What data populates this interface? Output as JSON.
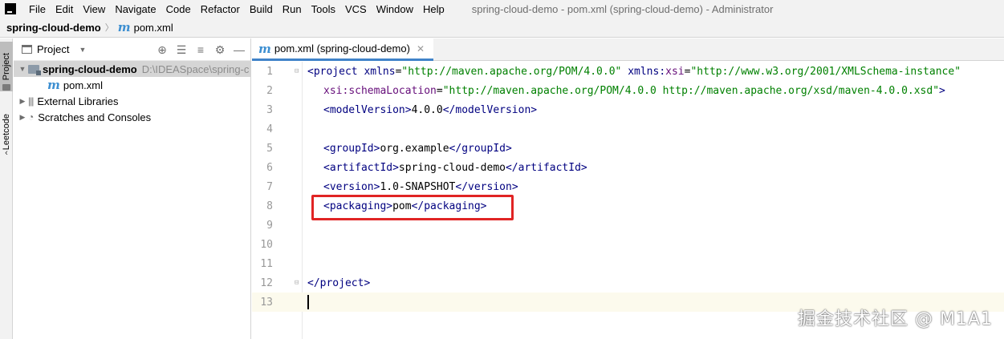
{
  "menubar": {
    "items": [
      {
        "label": "File",
        "mnemonic": "F"
      },
      {
        "label": "Edit",
        "mnemonic": "E"
      },
      {
        "label": "View",
        "mnemonic": "V"
      },
      {
        "label": "Navigate",
        "mnemonic": "N"
      },
      {
        "label": "Code",
        "mnemonic": "C"
      },
      {
        "label": "Refactor",
        "mnemonic": "R"
      },
      {
        "label": "Build",
        "mnemonic": "B"
      },
      {
        "label": "Run",
        "mnemonic": "u"
      },
      {
        "label": "Tools",
        "mnemonic": "T"
      },
      {
        "label": "VCS",
        "mnemonic": "S"
      },
      {
        "label": "Window",
        "mnemonic": "W"
      },
      {
        "label": "Help",
        "mnemonic": "H"
      }
    ],
    "window_title": "spring-cloud-demo - pom.xml (spring-cloud-demo) - Administrator"
  },
  "breadcrumb": {
    "project": "spring-cloud-demo",
    "file_icon": "m",
    "file": "pom.xml"
  },
  "toolstrip": {
    "project_tab": "Project",
    "leetcode_tab": "Leetcode"
  },
  "project_panel": {
    "title": "Project",
    "tree": {
      "root_label": "spring-cloud-demo",
      "root_path": "D:\\IDEASpace\\spring-c",
      "child_icon": "m",
      "child_label": "pom.xml",
      "libraries_label": "External Libraries",
      "scratches_label": "Scratches and Consoles"
    }
  },
  "editor": {
    "tab_icon": "m",
    "tab_label": "pom.xml (spring-cloud-demo)",
    "line_numbers": [
      "1",
      "2",
      "3",
      "4",
      "5",
      "6",
      "7",
      "8",
      "9",
      "10",
      "11",
      "12",
      "13"
    ],
    "code": {
      "l1_open": "<project ",
      "l1_attr1": "xmlns",
      "l1_eq1": "=",
      "l1_val1": "\"http://maven.apache.org/POM/4.0.0\"",
      "l1_attr2_ns": "xmlns:",
      "l1_attr2": "xsi",
      "l1_eq2": "=",
      "l1_val2": "\"http://www.w3.org/2001/XMLSchema-instance\"",
      "l2_attr_ns": "xsi:",
      "l2_attr": "schemaLocation",
      "l2_eq": "=",
      "l2_val": "\"http://maven.apache.org/POM/4.0.0 http://maven.apache.org/xsd/maven-4.0.0.xsd\"",
      "l2_close": ">",
      "l3_open": "<modelVersion>",
      "l3_text": "4.0.0",
      "l3_close": "</modelVersion>",
      "l5_open": "<groupId>",
      "l5_text": "org.example",
      "l5_close": "</groupId>",
      "l6_open": "<artifactId>",
      "l6_text": "spring-cloud-demo",
      "l6_close": "</artifactId>",
      "l7_open": "<version>",
      "l7_text": "1.0-SNAPSHOT",
      "l7_close": "</version>",
      "l8_open": "<packaging>",
      "l8_text": "pom",
      "l8_close": "</packaging>",
      "l12_close": "</project>"
    }
  },
  "watermark": "掘金技术社区 @ M1A1",
  "colors": {
    "highlight_box": "#e02424",
    "tab_underline": "#4083c9",
    "tag": "#000080",
    "string": "#008000",
    "namespace": "#660e7a",
    "current_line": "#fcfaed"
  }
}
